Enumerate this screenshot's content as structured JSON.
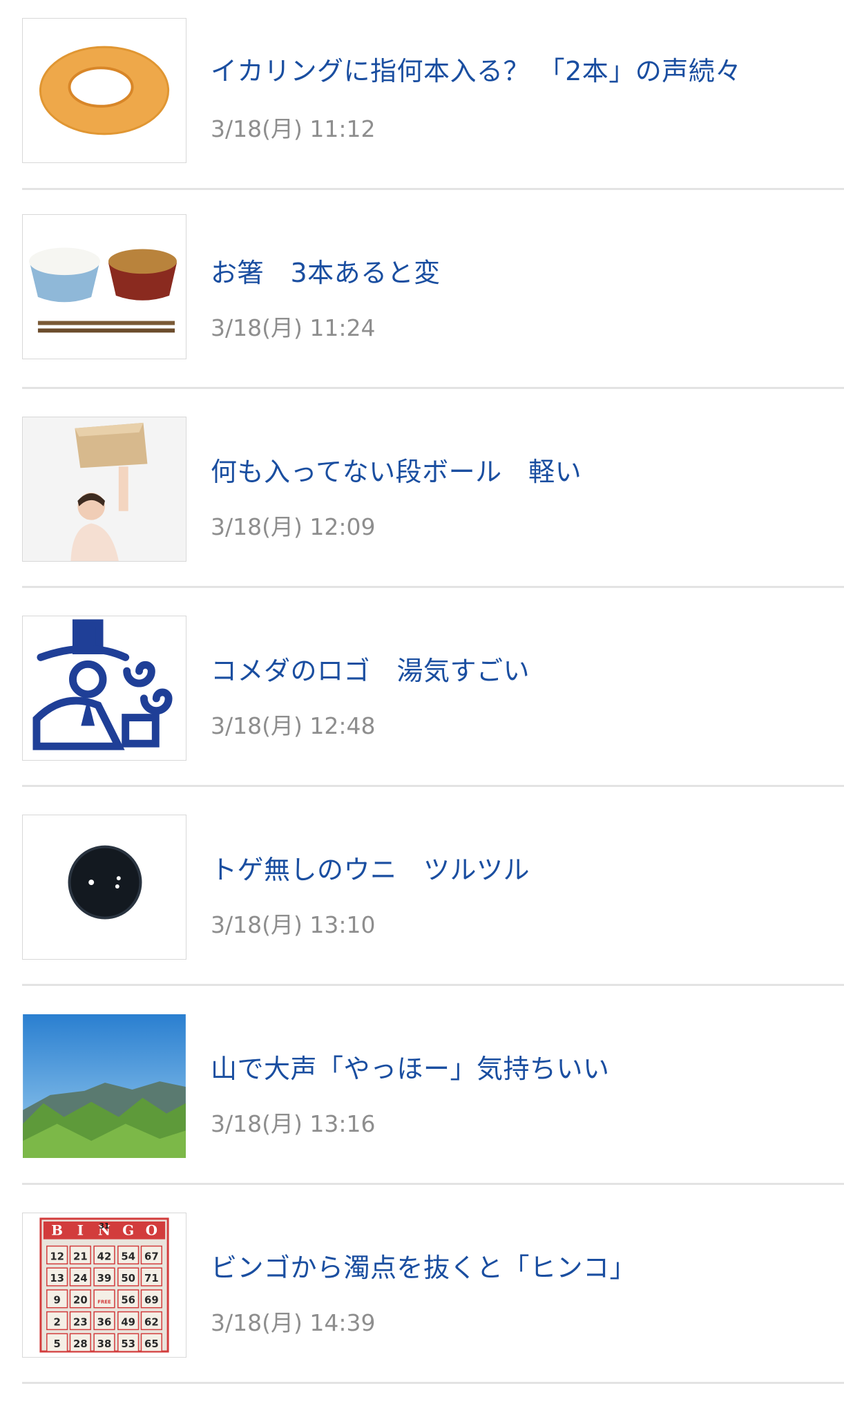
{
  "articles": [
    {
      "title": "イカリングに指何本入る？ 「2本」の声続々",
      "time": "3/18(月) 11:12",
      "thumbnail_icon": "onion-ring-icon"
    },
    {
      "title": "お箸　3本あると変",
      "time": "3/18(月) 11:24",
      "thumbnail_icon": "rice-soup-chopsticks-icon"
    },
    {
      "title": "何も入ってない段ボール　軽い",
      "time": "3/18(月) 12:09",
      "thumbnail_icon": "woman-lifting-box-icon"
    },
    {
      "title": "コメダのロゴ　湯気すごい",
      "time": "3/18(月) 12:48",
      "thumbnail_icon": "komeda-logo-icon"
    },
    {
      "title": "トゲ無しのウニ　ツルツル",
      "time": "3/18(月) 13:10",
      "thumbnail_icon": "black-ball-icon"
    },
    {
      "title": "山で大声「やっほー」気持ちいい",
      "time": "3/18(月) 13:16",
      "thumbnail_icon": "mountain-landscape-icon"
    },
    {
      "title": "ビンゴから濁点を抜くと「ヒンコ」",
      "time": "3/18(月) 14:39",
      "thumbnail_icon": "bingo-card-icon"
    }
  ],
  "bingo_card": {
    "header": [
      "B",
      "I",
      "N",
      "G",
      "O"
    ],
    "top_number": "31",
    "free_label": "FREE",
    "rows": [
      [
        "12",
        "21",
        "42",
        "54",
        "67"
      ],
      [
        "13",
        "24",
        "39",
        "50",
        "71"
      ],
      [
        "9",
        "20",
        "FREE",
        "56",
        "69"
      ],
      [
        "2",
        "23",
        "36",
        "49",
        "62"
      ],
      [
        "5",
        "28",
        "38",
        "53",
        "65"
      ]
    ]
  },
  "colors": {
    "title": "#1a4ea0",
    "time": "#8e8e8e",
    "divider": "#e3e3e3",
    "komeda_blue": "#1f3f97",
    "bingo_red": "#d23c3c"
  }
}
